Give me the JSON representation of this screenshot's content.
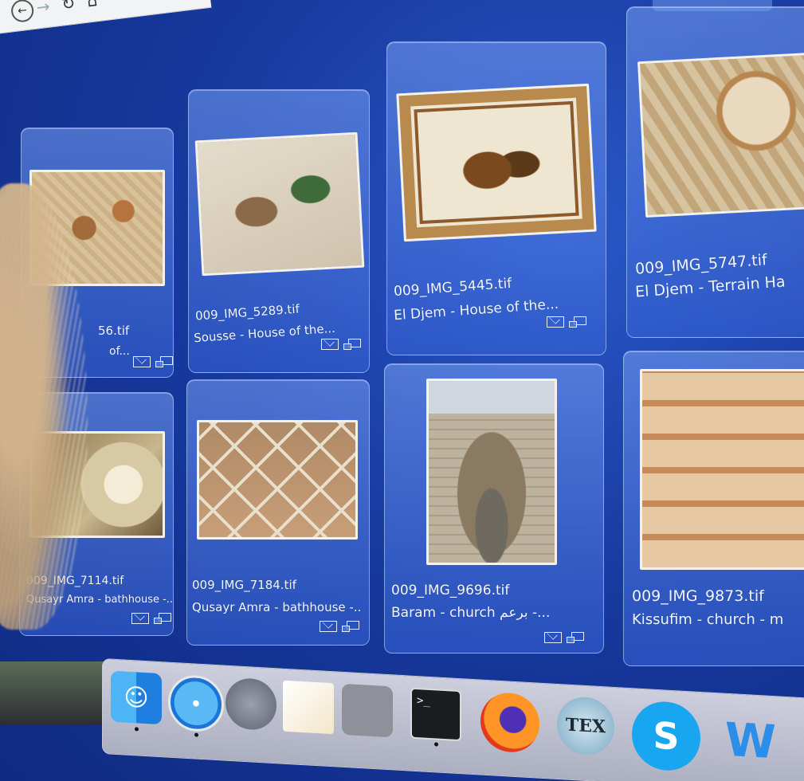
{
  "colors": {
    "desktop": "#173aa0",
    "card": "#5a8de8",
    "text": "#f2f6ff"
  },
  "browser": {
    "back_glyph": "←",
    "forward_glyph": "→",
    "reload_glyph": "↻",
    "home_glyph": "⌂"
  },
  "cards": [
    {
      "file": "009_IMG_5289.tif",
      "desc": "Sousse - House of the..."
    },
    {
      "file": "009_IMG_5445.tif",
      "desc": "El Djem - House of the..."
    },
    {
      "file": "009_IMG_5747.tif",
      "desc": "El Djem - Terrain Ha"
    },
    {
      "file": "009_IMG_7114.tif",
      "desc": "Qusayr Amra - bathhouse -.."
    },
    {
      "file": "009_IMG_7184.tif",
      "desc": "Qusayr Amra - bathhouse -.."
    },
    {
      "file": "009_IMG_9696.tif",
      "desc": "Baram - church برعم -..."
    },
    {
      "file": "009_IMG_9873.tif",
      "desc": "Kissufim - church - m"
    }
  ],
  "partial_card": {
    "file_fragment": "56.tif",
    "desc_fragment": "of..."
  },
  "dock": {
    "finder_glyph": "☺",
    "terminal_prompt": ">_",
    "tex_label": "TEX",
    "skype_label": "S",
    "word_label": "W"
  }
}
